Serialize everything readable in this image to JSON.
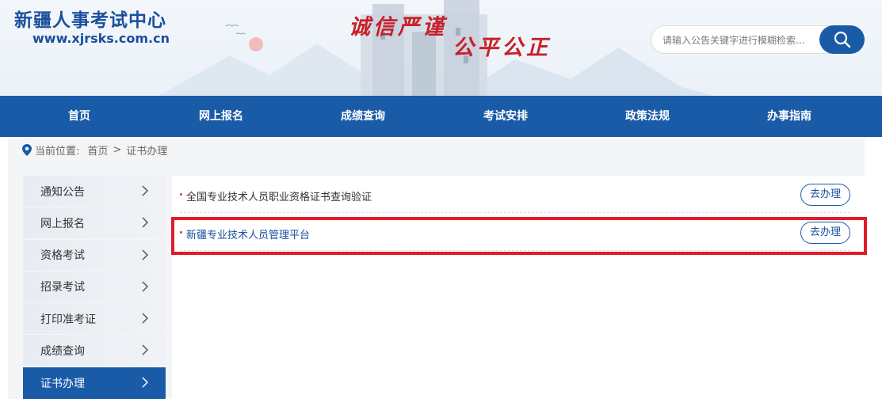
{
  "header": {
    "site_title": "新疆人事考试中心",
    "site_url": "www.xjrsks.com.cn",
    "slogan_left": "诚信严谨",
    "slogan_right": "公平公正",
    "search_placeholder": "请输入公告关键字进行模糊检索..."
  },
  "nav": {
    "items": [
      "首页",
      "网上报名",
      "成绩查询",
      "考试安排",
      "政策法规",
      "办事指南"
    ]
  },
  "breadcrumb": {
    "prefix": "当前位置:",
    "home": "首页",
    "separator": ">",
    "current": "证书办理"
  },
  "sidebar": {
    "items": [
      {
        "label": "通知公告"
      },
      {
        "label": "网上报名"
      },
      {
        "label": "资格考试"
      },
      {
        "label": "招录考试"
      },
      {
        "label": "打印准考证"
      },
      {
        "label": "成绩查询"
      },
      {
        "label": "证书办理"
      }
    ],
    "active_label": "证书办理"
  },
  "main": {
    "rows": [
      {
        "title": "全国专业技术人员职业资格证书查询验证",
        "action": "去办理"
      },
      {
        "title": "新疆专业技术人员管理平台",
        "action": "去办理"
      }
    ]
  },
  "colors": {
    "brand_blue": "#1a5ba8",
    "slogan_red": "#c8202a",
    "highlight_red": "#e11b2a"
  }
}
